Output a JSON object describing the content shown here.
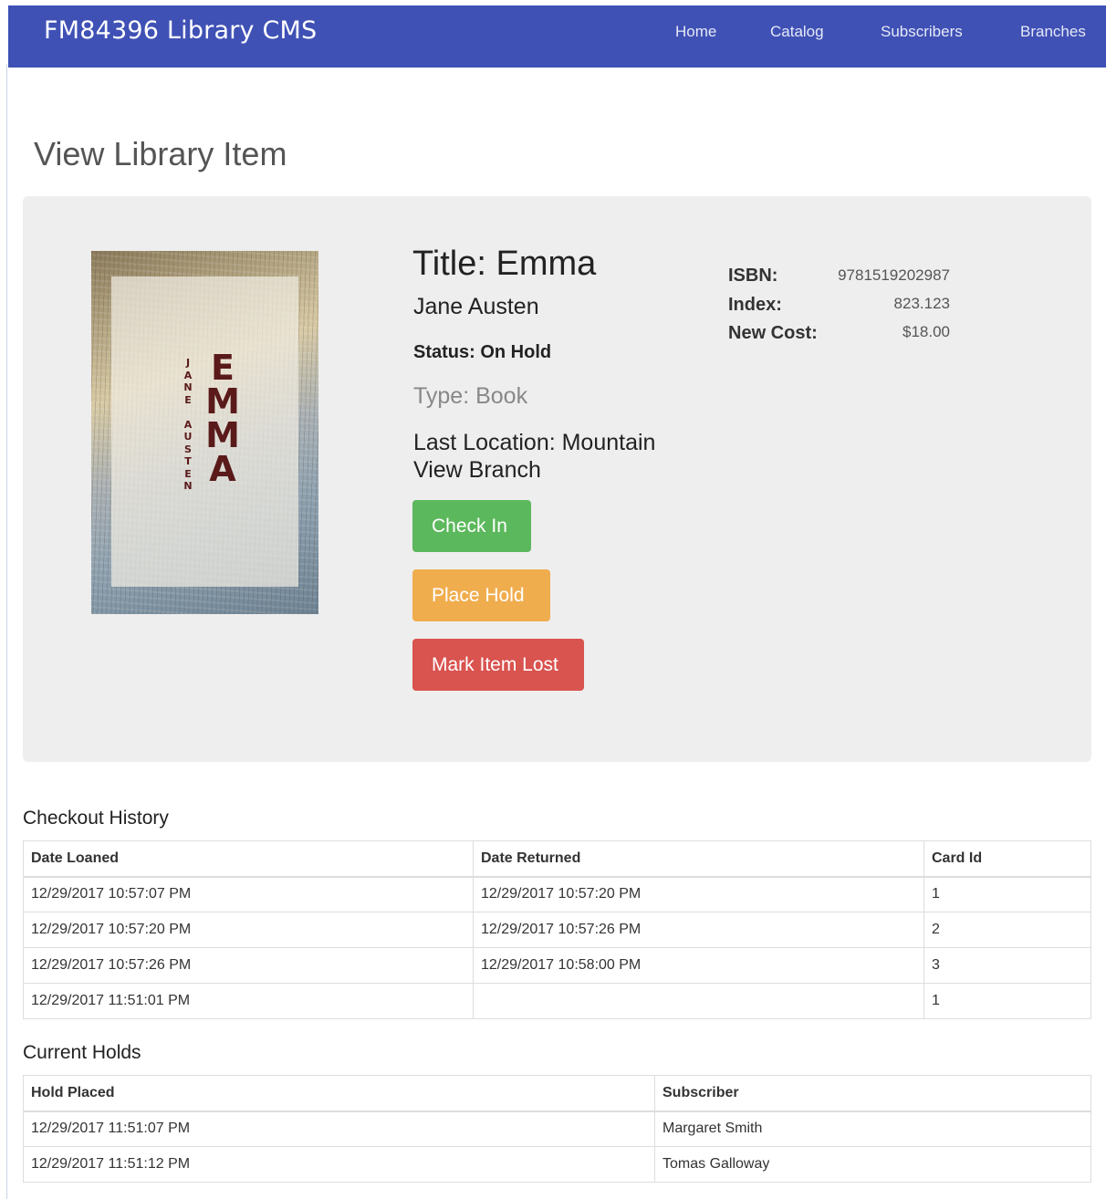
{
  "navbar": {
    "brand": "FM84396 Library CMS",
    "links": [
      "Home",
      "Catalog",
      "Subscribers",
      "Branches"
    ]
  },
  "page": {
    "title": "View Library Item"
  },
  "item": {
    "cover": {
      "title_text": "EMMA",
      "author_text": "JANE AUSTEN"
    },
    "title": "Title: Emma",
    "author": "Jane Austen",
    "status": "Status: On Hold",
    "type": "Type: Book",
    "location": "Last Location: Mountain View Branch",
    "details": [
      {
        "label": "ISBN:",
        "value": "9781519202987"
      },
      {
        "label": "Index:",
        "value": "823.123"
      },
      {
        "label": "New Cost:",
        "value": "$18.00"
      }
    ]
  },
  "buttons": {
    "check_in": "Check In",
    "place_hold": "Place Hold",
    "mark_lost": "Mark Item Lost"
  },
  "checkout_history": {
    "heading": "Checkout History",
    "columns": [
      "Date Loaned",
      "Date Returned",
      "Card Id"
    ],
    "rows": [
      [
        "12/29/2017 10:57:07 PM",
        "12/29/2017 10:57:20 PM",
        "1"
      ],
      [
        "12/29/2017 10:57:20 PM",
        "12/29/2017 10:57:26 PM",
        "2"
      ],
      [
        "12/29/2017 10:57:26 PM",
        "12/29/2017 10:58:00 PM",
        "3"
      ],
      [
        "12/29/2017 11:51:01 PM",
        "",
        "1"
      ]
    ]
  },
  "current_holds": {
    "heading": "Current Holds",
    "columns": [
      "Hold Placed",
      "Subscriber"
    ],
    "rows": [
      [
        "12/29/2017 11:51:07 PM",
        "Margaret Smith"
      ],
      [
        "12/29/2017 11:51:12 PM",
        "Tomas Galloway"
      ]
    ]
  },
  "colors": {
    "navbar": "#3f51b5",
    "success": "#5cb85c",
    "warning": "#f0ad4e",
    "danger": "#d9534f",
    "jumbotron": "#eeeeee"
  }
}
